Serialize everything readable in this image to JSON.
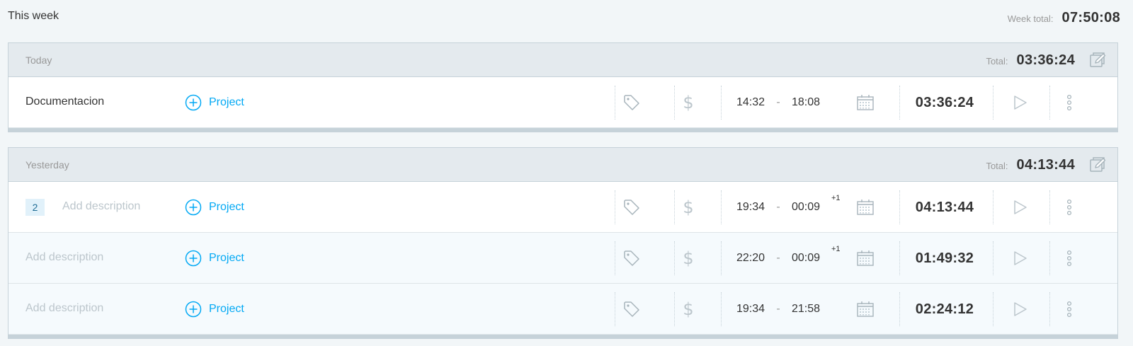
{
  "week": {
    "title": "This week",
    "total_label": "Week total:",
    "total_value": "07:50:08"
  },
  "colors": {
    "accent": "#03a9f4",
    "header_bg": "#e4eaee",
    "page_bg": "#f2f6f8"
  },
  "icons": {
    "tag": "tag-icon",
    "billable": "dollar-icon",
    "date": "calendar-icon",
    "continue": "play-icon",
    "more": "more-vertical-icon",
    "bulk_edit": "bulk-edit-icon",
    "project": "plus-circle-icon"
  },
  "days": [
    {
      "label": "Today",
      "total_label": "Total:",
      "total_value": "03:36:24",
      "entries": [
        {
          "count": "",
          "description": "Documentacion",
          "placeholder": false,
          "project_label": "Project",
          "start": "14:32",
          "dash": "-",
          "end": "18:08",
          "next_day": "",
          "duration": "03:36:24"
        }
      ]
    },
    {
      "label": "Yesterday",
      "total_label": "Total:",
      "total_value": "04:13:44",
      "entries": [
        {
          "count": "2",
          "description": "Add description",
          "placeholder": true,
          "project_label": "Project",
          "start": "19:34",
          "dash": "-",
          "end": "00:09",
          "next_day": "+1",
          "duration": "04:13:44"
        },
        {
          "count": "",
          "description": "Add description",
          "placeholder": true,
          "project_label": "Project",
          "start": "22:20",
          "dash": "-",
          "end": "00:09",
          "next_day": "+1",
          "duration": "01:49:32"
        },
        {
          "count": "",
          "description": "Add description",
          "placeholder": true,
          "project_label": "Project",
          "start": "19:34",
          "dash": "-",
          "end": "21:58",
          "next_day": "",
          "duration": "02:24:12"
        }
      ]
    }
  ]
}
